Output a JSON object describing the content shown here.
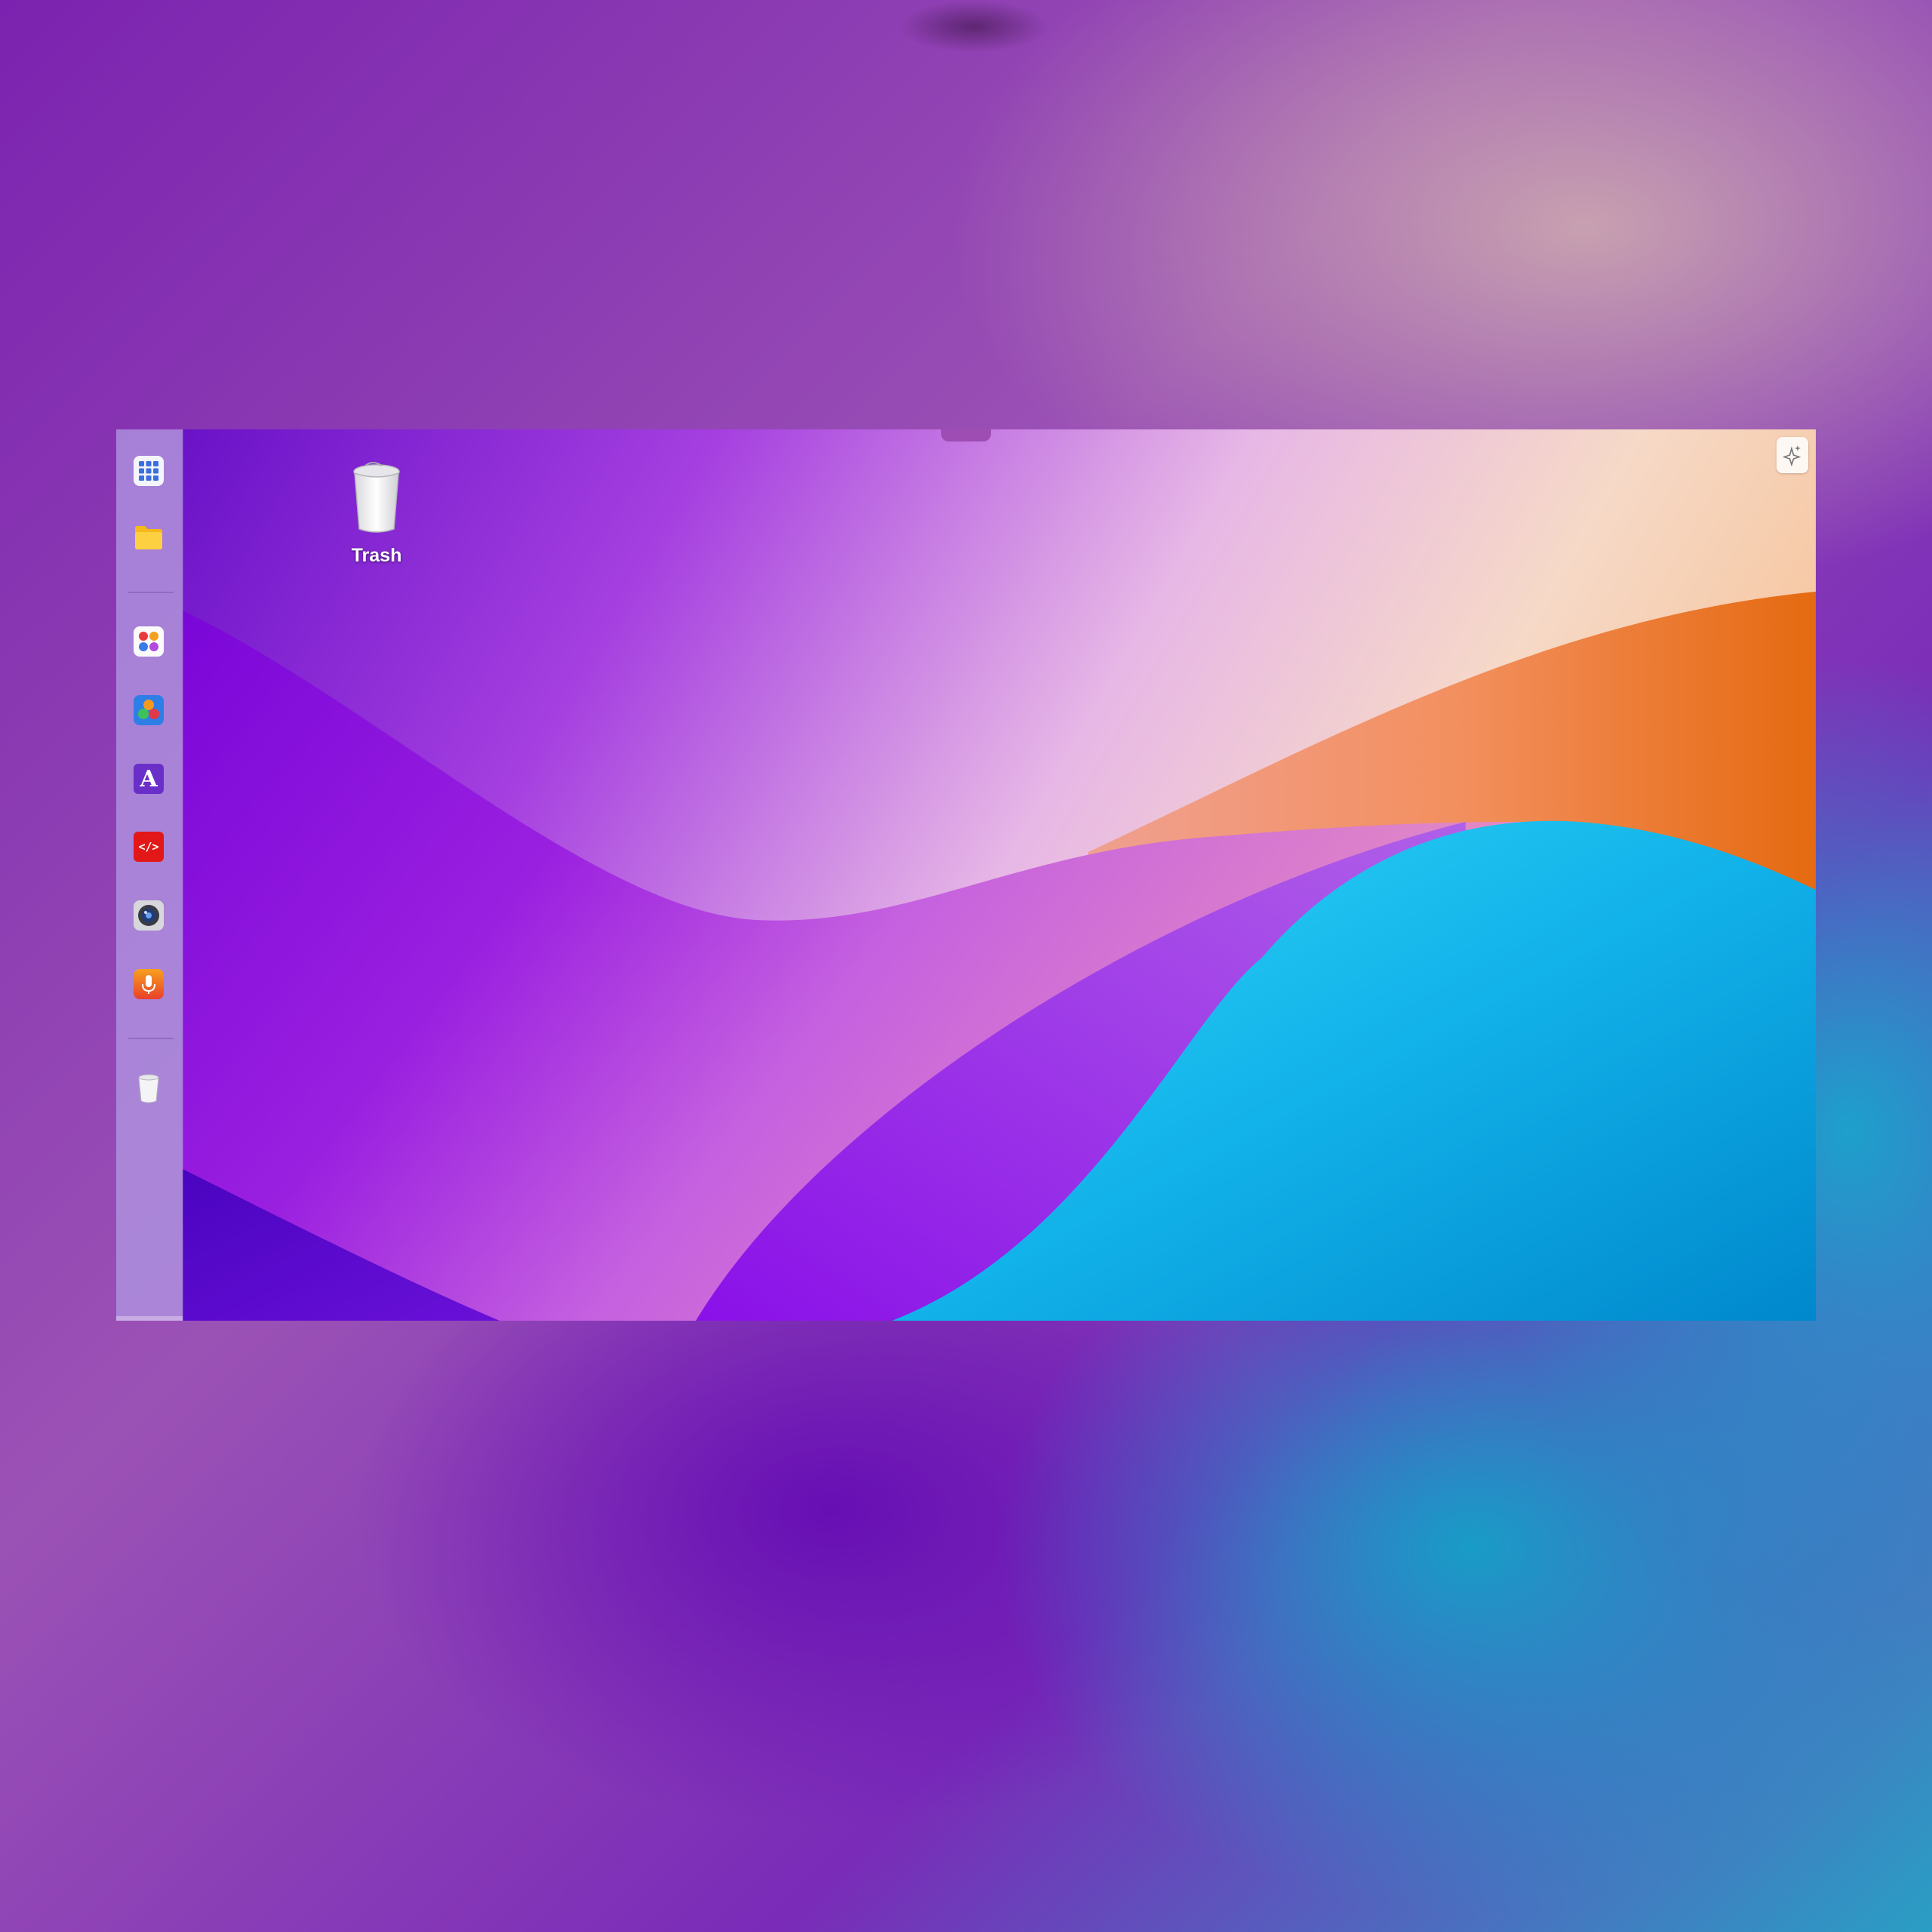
{
  "desktop": {
    "icons": [
      {
        "label": "Trash",
        "icon": "trash-icon"
      }
    ]
  },
  "dock": {
    "items": [
      {
        "name": "launchpad",
        "icon": "grid-icon"
      },
      {
        "name": "files",
        "icon": "folder-icon"
      },
      {
        "name": "app-1",
        "icon": "apps-icon"
      },
      {
        "name": "app-2",
        "icon": "color-balls-icon"
      },
      {
        "name": "font-app",
        "icon": "font-a-icon",
        "glyph": "A"
      },
      {
        "name": "code-editor",
        "icon": "code-icon",
        "glyph": "</>"
      },
      {
        "name": "camera",
        "icon": "camera-lens-icon"
      },
      {
        "name": "voice-recorder",
        "icon": "microphone-icon"
      },
      {
        "name": "trash",
        "icon": "trash-icon"
      }
    ]
  },
  "corner_button": {
    "icon": "sparkle-icon"
  },
  "colors": {
    "dock_bg": "#AF96E1",
    "wave_purple": "#8A10E0",
    "wave_orange": "#E87420",
    "wave_cyan": "#14B8EC"
  }
}
